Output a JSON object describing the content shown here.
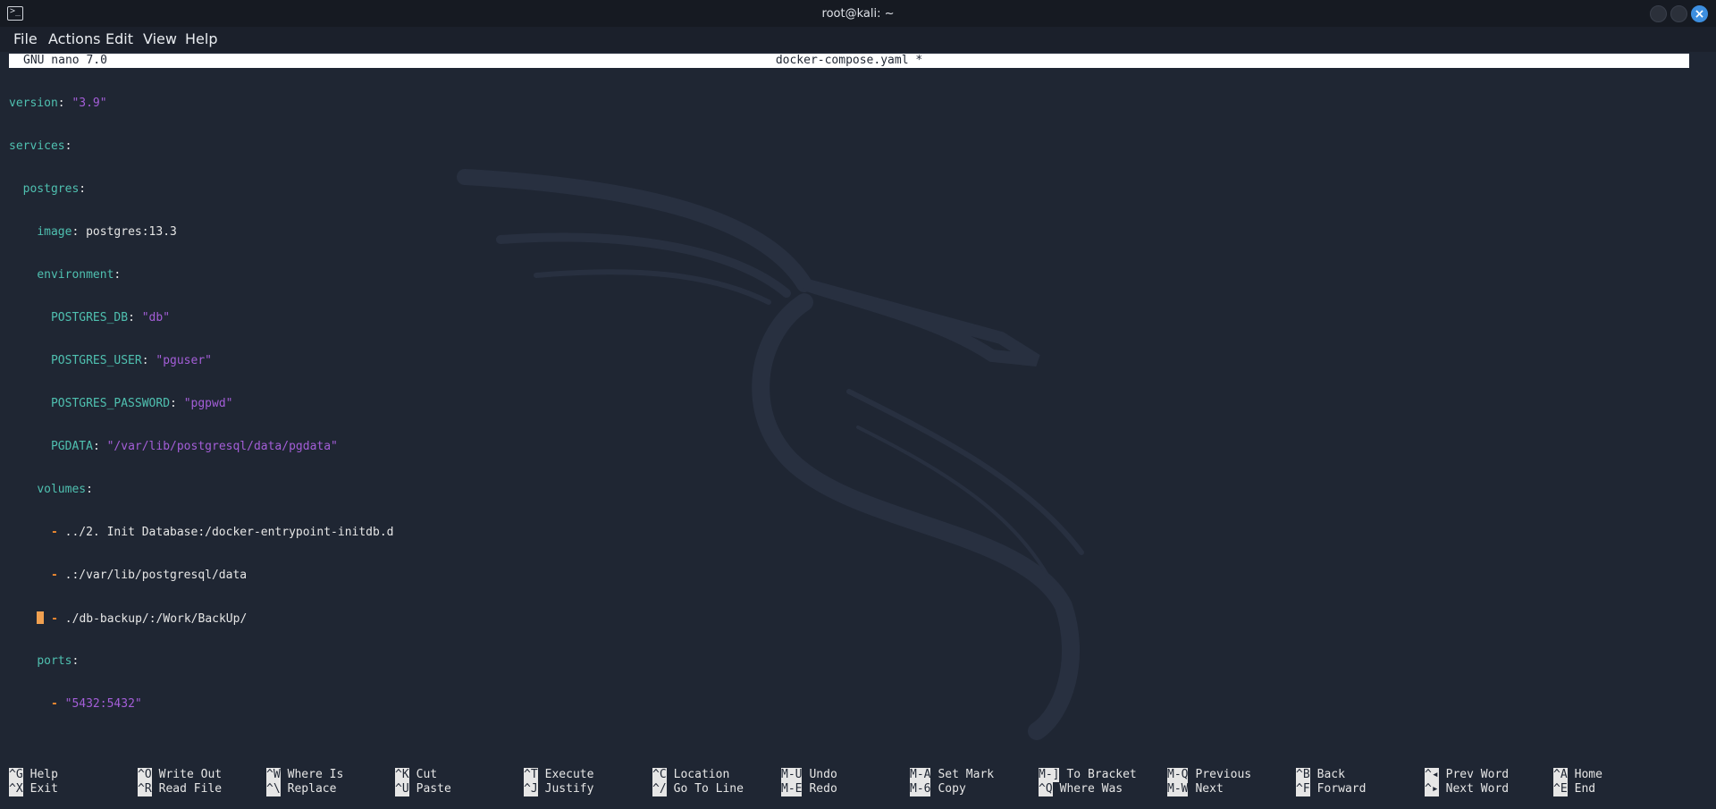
{
  "window": {
    "title": "root@kali: ~",
    "terminal_icon": "terminal-icon",
    "buttons": [
      "minimize",
      "maximize",
      "close"
    ]
  },
  "menubar": {
    "items": [
      "File",
      "Actions",
      "Edit",
      "View",
      "Help"
    ]
  },
  "nano": {
    "version": "GNU nano 7.0",
    "filename": "docker-compose.yaml *"
  },
  "code": {
    "l1_key": "version",
    "l1_val": "\"3.9\"",
    "l2_key": "services",
    "l3_key": "postgres",
    "l4_key": "image",
    "l4_val": "postgres:13.3",
    "l5_key": "environment",
    "l6_key": "POSTGRES_DB",
    "l6_val": "\"db\"",
    "l7_key": "POSTGRES_USER",
    "l7_val": "\"pguser\"",
    "l8_key": "POSTGRES_PASSWORD",
    "l8_val": "\"pgpwd\"",
    "l9_key": "PGDATA",
    "l9_val": "\"/var/lib/postgresql/data/pgdata\"",
    "l10_key": "volumes",
    "l11_val": "../2. Init Database:/docker-entrypoint-initdb.d",
    "l12_val": ".:/var/lib/postgresql/data",
    "l13_val": "./db-backup/:/Work/BackUp/",
    "l14_key": "ports",
    "l15_val": "\"5432:5432\""
  },
  "shortcuts": [
    {
      "top_key": "^G",
      "top_label": "Help",
      "bottom_key": "^X",
      "bottom_label": "Exit"
    },
    {
      "top_key": "^O",
      "top_label": "Write Out",
      "bottom_key": "^R",
      "bottom_label": "Read File"
    },
    {
      "top_key": "^W",
      "top_label": "Where Is",
      "bottom_key": "^\\",
      "bottom_label": "Replace"
    },
    {
      "top_key": "^K",
      "top_label": "Cut",
      "bottom_key": "^U",
      "bottom_label": "Paste"
    },
    {
      "top_key": "^T",
      "top_label": "Execute",
      "bottom_key": "^J",
      "bottom_label": "Justify"
    },
    {
      "top_key": "^C",
      "top_label": "Location",
      "bottom_key": "^/",
      "bottom_label": "Go To Line"
    },
    {
      "top_key": "M-U",
      "top_label": "Undo",
      "bottom_key": "M-E",
      "bottom_label": "Redo"
    },
    {
      "top_key": "M-A",
      "top_label": "Set Mark",
      "bottom_key": "M-6",
      "bottom_label": "Copy"
    },
    {
      "top_key": "M-]",
      "top_label": "To Bracket",
      "bottom_key": "^Q",
      "bottom_label": "Where Was"
    },
    {
      "top_key": "M-Q",
      "top_label": "Previous",
      "bottom_key": "M-W",
      "bottom_label": "Next"
    },
    {
      "top_key": "^B",
      "top_label": "Back",
      "bottom_key": "^F",
      "bottom_label": "Forward"
    },
    {
      "top_key": "^◂",
      "top_label": "Prev Word",
      "bottom_key": "^▸",
      "bottom_label": "Next Word"
    },
    {
      "top_key": "^A",
      "top_label": "Home",
      "bottom_key": "^E",
      "bottom_label": "End"
    }
  ],
  "colors": {
    "key": "#4fc0b0",
    "string": "#a45ed8",
    "dash": "#f08a30",
    "background": "#1f2633"
  }
}
